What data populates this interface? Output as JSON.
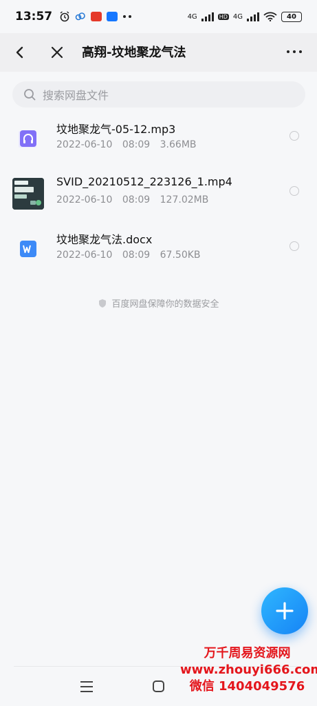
{
  "status_bar": {
    "time": "13:57",
    "network_1": "4G",
    "network_2": "4G",
    "hd_label": "HD",
    "battery": "40",
    "icons": [
      "alarm-icon",
      "cloud-app-icon",
      "red-app-icon",
      "alipay-icon",
      "more-dots-icon",
      "wifi-icon"
    ]
  },
  "header": {
    "title": "高翔-坟地聚龙气法",
    "back_icon": "back-arrow-icon",
    "close_icon": "close-icon",
    "more_icon": "more-icon"
  },
  "search": {
    "placeholder": "搜索网盘文件",
    "icon": "search-icon"
  },
  "files": [
    {
      "name": "坟地聚龙气-05-12.mp3",
      "date": "2022-06-10",
      "time": "08:09",
      "size": "3.66MB",
      "icon": "audio-file-icon"
    },
    {
      "name": "SVID_20210512_223126_1.mp4",
      "date": "2022-06-10",
      "time": "08:09",
      "size": "127.02MB",
      "icon": "video-thumbnail"
    },
    {
      "name": "坟地聚龙气法.docx",
      "date": "2022-06-10",
      "time": "08:09",
      "size": "67.50KB",
      "icon": "word-file-icon"
    }
  ],
  "footer_note": "百度网盘保障你的数据安全",
  "fab_icon": "plus-icon",
  "watermark": {
    "line1": "万千周易资源网",
    "line2": "www.zhouyi666.com",
    "line3": "微信 1404049576"
  },
  "nav": {
    "menu_icon": "menu-icon",
    "home_icon": "home-icon"
  },
  "colors": {
    "accent": "#1684f5",
    "audio": "#7b6cf6",
    "word": "#3d8af7",
    "watermark": "#e4161c"
  }
}
